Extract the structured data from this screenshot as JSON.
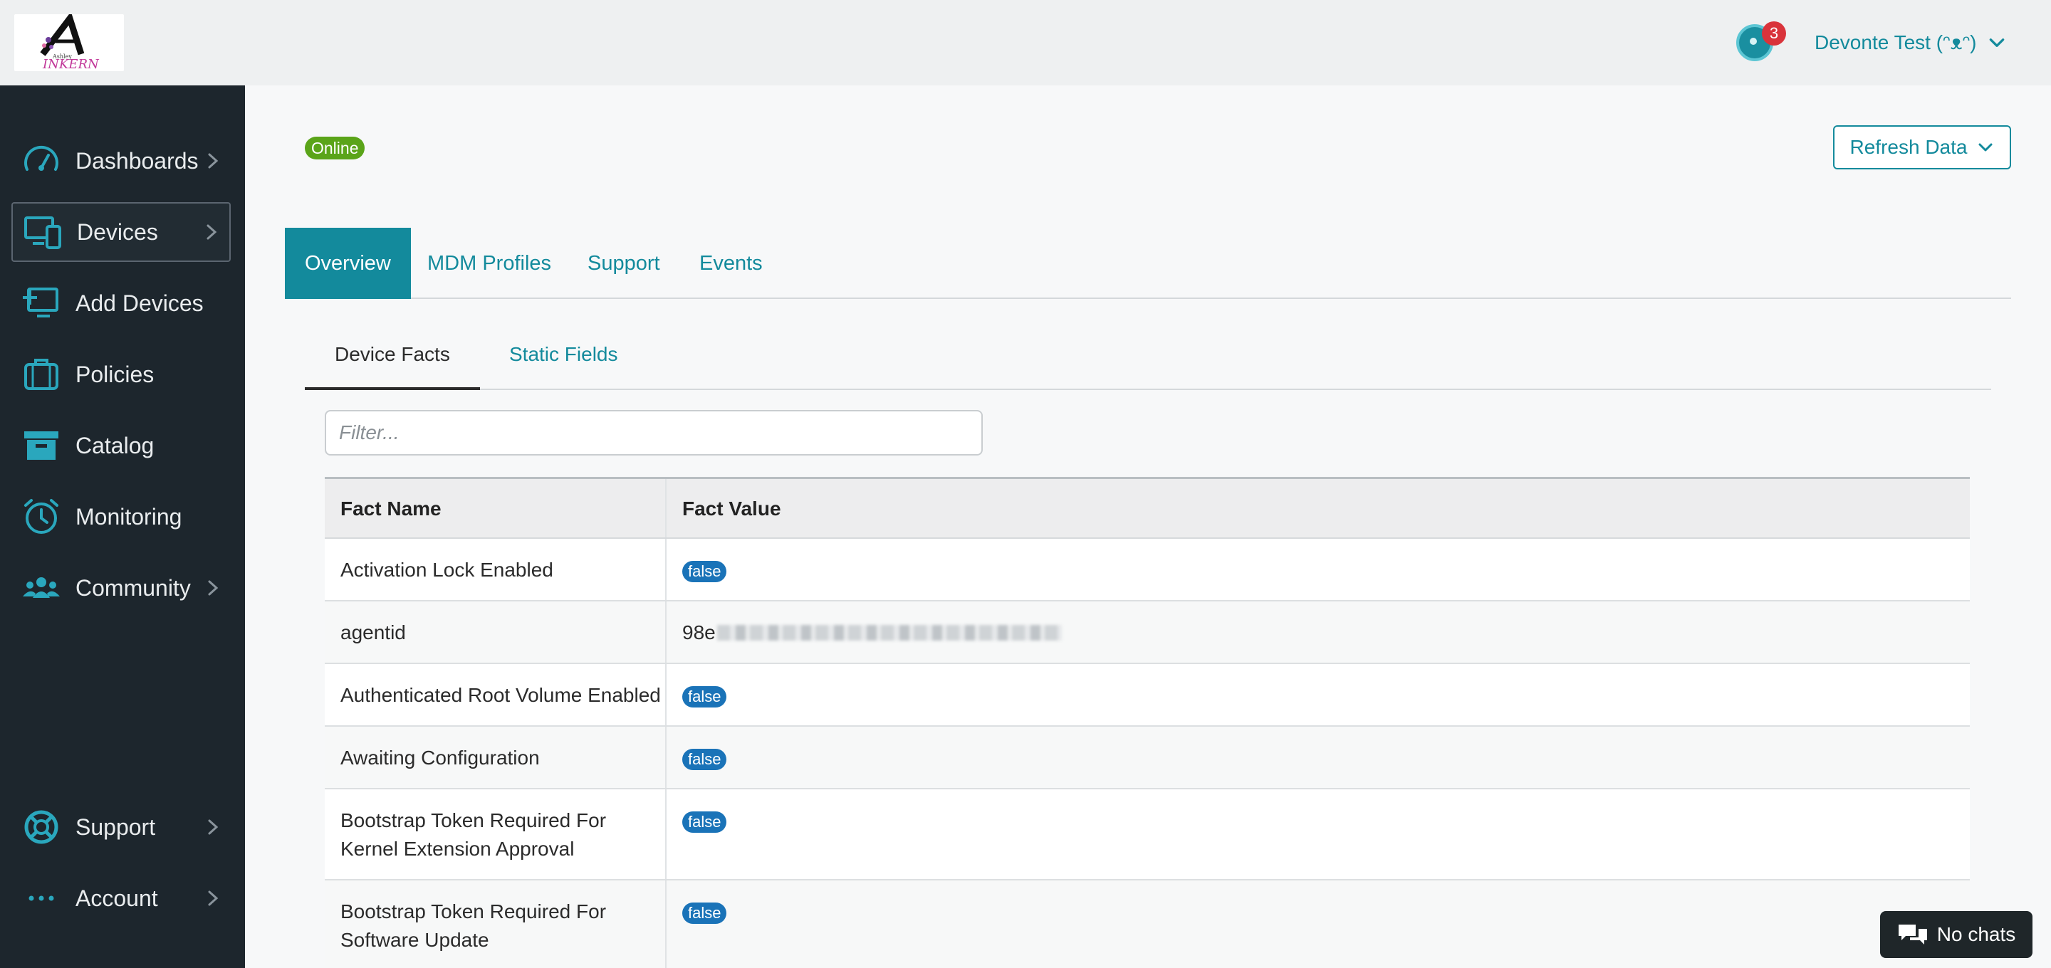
{
  "header": {
    "notification_count": "3",
    "user_name": "Devonte Test (ᵔᴥᵔ)"
  },
  "sidebar": {
    "items": [
      {
        "label": "Dashboards",
        "icon": "gauge-icon",
        "has_chevron": true
      },
      {
        "label": "Devices",
        "icon": "devices-icon",
        "has_chevron": true,
        "active": true
      },
      {
        "label": "Add Devices",
        "icon": "add-device-icon",
        "has_chevron": false
      },
      {
        "label": "Policies",
        "icon": "briefcase-icon",
        "has_chevron": false
      },
      {
        "label": "Catalog",
        "icon": "archive-box-icon",
        "has_chevron": false
      },
      {
        "label": "Monitoring",
        "icon": "alarm-clock-icon",
        "has_chevron": false
      },
      {
        "label": "Community",
        "icon": "users-icon",
        "has_chevron": true
      },
      {
        "label": "Support",
        "icon": "lifebuoy-icon",
        "has_chevron": true
      },
      {
        "label": "Account",
        "icon": "ellipsis-icon",
        "has_chevron": true
      }
    ],
    "accent_color": "#2aa7bd"
  },
  "main": {
    "status": "Online",
    "refresh_label": "Refresh Data",
    "tabs": [
      {
        "label": "Overview",
        "active": true
      },
      {
        "label": "MDM Profiles"
      },
      {
        "label": "Support"
      },
      {
        "label": "Events"
      }
    ],
    "subtabs": [
      {
        "label": "Device Facts",
        "active": true
      },
      {
        "label": "Static Fields"
      }
    ],
    "filter_placeholder": "Filter...",
    "table": {
      "headers": [
        "Fact Name",
        "Fact Value"
      ],
      "rows": [
        {
          "name": "Activation Lock Enabled",
          "value": "false",
          "type": "badge"
        },
        {
          "name": "agentid",
          "value": "98e",
          "type": "redacted"
        },
        {
          "name": "Authenticated Root Volume Enabled",
          "value": "false",
          "type": "badge"
        },
        {
          "name": "Awaiting Configuration",
          "value": "false",
          "type": "badge"
        },
        {
          "name": "Bootstrap Token Required For Kernel Extension Approval",
          "value": "false",
          "type": "badge"
        },
        {
          "name": "Bootstrap Token Required For Software Update",
          "value": "false",
          "type": "badge"
        }
      ]
    }
  },
  "chat": {
    "label": "No chats"
  },
  "colors": {
    "brand": "#138a9c",
    "online": "#5aa419",
    "badge_blue": "#1a73b8",
    "sidebar_bg": "#1d262d"
  }
}
